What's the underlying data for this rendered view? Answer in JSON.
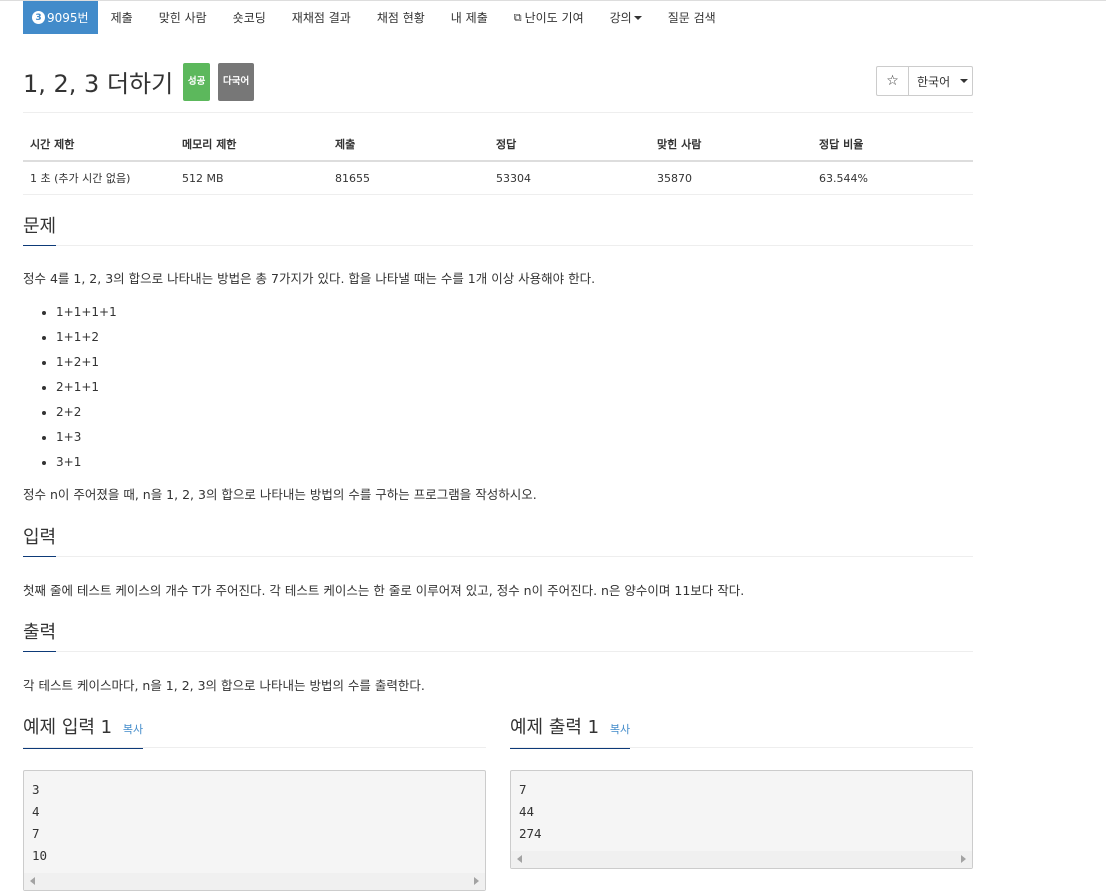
{
  "nav": {
    "problem_level": "3",
    "problem_id": "9095번",
    "items": [
      "제출",
      "맞힌 사람",
      "숏코딩",
      "재채점 결과",
      "채점 현황",
      "내 제출",
      "난이도 기여",
      "강의",
      "질문 검색"
    ]
  },
  "problem": {
    "title": "1, 2, 3 더하기",
    "labels": [
      "성공",
      "다국어"
    ],
    "star": "☆",
    "language": "한국어"
  },
  "info_table": {
    "headers": [
      "시간 제한",
      "메모리 제한",
      "제출",
      "정답",
      "맞힌 사람",
      "정답 비율"
    ],
    "values": [
      "1 초 (추가 시간 없음)",
      "512 MB",
      "81655",
      "53304",
      "35870",
      "63.544%"
    ]
  },
  "sections": {
    "problem": {
      "heading": "문제",
      "intro": "정수 4를 1, 2, 3의 합으로 나타내는 방법은 총 7가지가 있다. 합을 나타낼 때는 수를 1개 이상 사용해야 한다.",
      "list": [
        "1+1+1+1",
        "1+1+2",
        "1+2+1",
        "2+1+1",
        "2+2",
        "1+3",
        "3+1"
      ],
      "task": "정수 n이 주어졌을 때, n을 1, 2, 3의 합으로 나타내는 방법의 수를 구하는 프로그램을 작성하시오."
    },
    "input": {
      "heading": "입력",
      "text": "첫째 줄에 테스트 케이스의 개수 T가 주어진다. 각 테스트 케이스는 한 줄로 이루어져 있고, 정수 n이 주어진다. n은 양수이며 11보다 작다."
    },
    "output": {
      "heading": "출력",
      "text": "각 테스트 케이스마다, n을 1, 2, 3의 합으로 나타내는 방법의 수를 출력한다."
    }
  },
  "samples": {
    "input": {
      "heading": "예제 입력 1",
      "copy": "복사",
      "lines": [
        "3",
        "4",
        "7",
        "10"
      ]
    },
    "output": {
      "heading": "예제 출력 1",
      "copy": "복사",
      "lines": [
        "7",
        "44",
        "274"
      ]
    }
  },
  "colors": {
    "primary": "#428bca",
    "success": "#5cb85c",
    "default_label": "#777777"
  }
}
